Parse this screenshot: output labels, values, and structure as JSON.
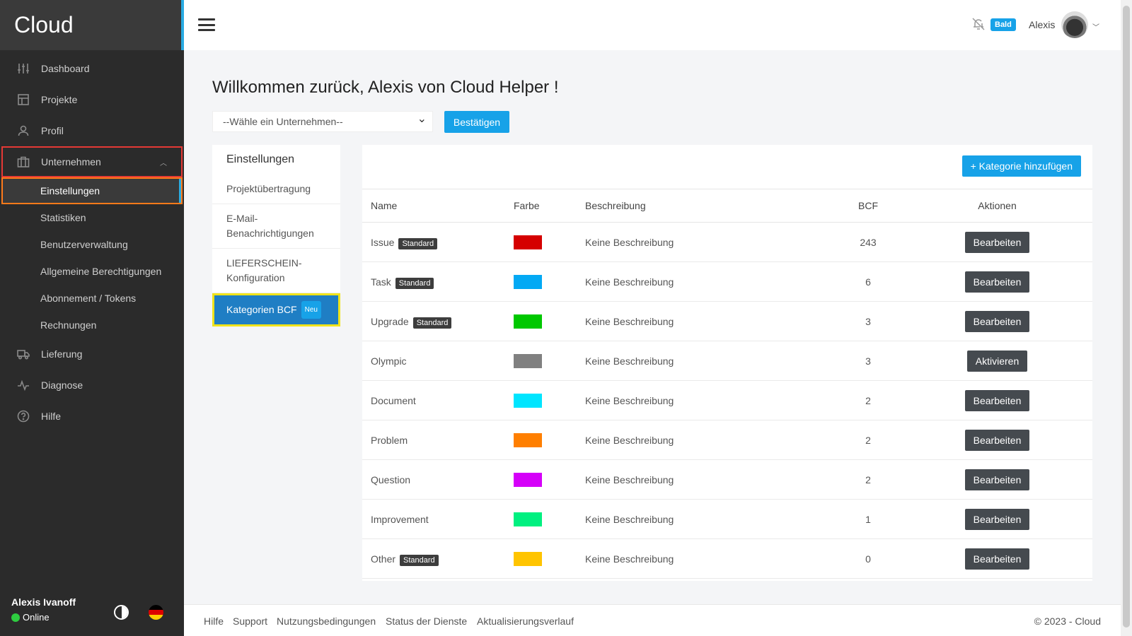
{
  "brand": "Cloud",
  "sidebar": {
    "items": [
      {
        "label": "Dashboard",
        "icon": "sliders-icon"
      },
      {
        "label": "Projekte",
        "icon": "layout-icon"
      },
      {
        "label": "Profil",
        "icon": "user-icon"
      },
      {
        "label": "Unternehmen",
        "icon": "briefcase-icon"
      },
      {
        "label": "Lieferung",
        "icon": "truck-icon"
      },
      {
        "label": "Diagnose",
        "icon": "activity-icon"
      },
      {
        "label": "Hilfe",
        "icon": "help-icon"
      }
    ],
    "subitems": [
      "Einstellungen",
      "Statistiken",
      "Benutzerverwaltung",
      "Allgemeine Berechtigungen",
      "Abonnement / Tokens",
      "Rechnungen"
    ],
    "user_name": "Alexis Ivanoff",
    "status": "Online"
  },
  "topbar": {
    "badge": "Bald",
    "user": "Alexis"
  },
  "main": {
    "welcome": "Willkommen zurück, Alexis von Cloud Helper !",
    "company_select": "--Wähle ein Unternehmen--",
    "confirm_label": "Bestätigen"
  },
  "settings": {
    "title": "Einstellungen",
    "items": [
      "Projektübertragung",
      "E-Mail-Benachrichtigungen",
      "LIEFERSCHEIN-Konfiguration"
    ],
    "active_item": "Kategorien BCF",
    "active_badge": "Neu"
  },
  "categories": {
    "add_label": "+ Kategorie hinzufügen",
    "standard_badge": "Standard",
    "columns": [
      "Name",
      "Farbe",
      "Beschreibung",
      "BCF",
      "Aktionen"
    ],
    "rows": [
      {
        "name": "Issue",
        "standard": true,
        "color": "#d50000",
        "description": "Keine Beschreibung",
        "bcf": "243",
        "action": "Bearbeiten"
      },
      {
        "name": "Task",
        "standard": true,
        "color": "#03a9f4",
        "description": "Keine Beschreibung",
        "bcf": "6",
        "action": "Bearbeiten"
      },
      {
        "name": "Upgrade",
        "standard": true,
        "color": "#00c800",
        "description": "Keine Beschreibung",
        "bcf": "3",
        "action": "Bearbeiten"
      },
      {
        "name": "Olympic",
        "standard": false,
        "color": "#808080",
        "description": "Keine Beschreibung",
        "bcf": "3",
        "action": "Aktivieren"
      },
      {
        "name": "Document",
        "standard": false,
        "color": "#00e5ff",
        "description": "Keine Beschreibung",
        "bcf": "2",
        "action": "Bearbeiten"
      },
      {
        "name": "Problem",
        "standard": false,
        "color": "#ff7f00",
        "description": "Keine Beschreibung",
        "bcf": "2",
        "action": "Bearbeiten"
      },
      {
        "name": "Question",
        "standard": false,
        "color": "#d500f9",
        "description": "Keine Beschreibung",
        "bcf": "2",
        "action": "Bearbeiten"
      },
      {
        "name": "Improvement",
        "standard": false,
        "color": "#00f080",
        "description": "Keine Beschreibung",
        "bcf": "1",
        "action": "Bearbeiten"
      },
      {
        "name": "Other",
        "standard": true,
        "color": "#ffc400",
        "description": "Keine Beschreibung",
        "bcf": "0",
        "action": "Bearbeiten"
      }
    ]
  },
  "footer": {
    "links": [
      "Hilfe",
      "Support",
      "Nutzungsbedingungen",
      "Status der Dienste",
      "Aktualisierungsverlauf"
    ],
    "copyright": "© 2023 - Cloud"
  }
}
